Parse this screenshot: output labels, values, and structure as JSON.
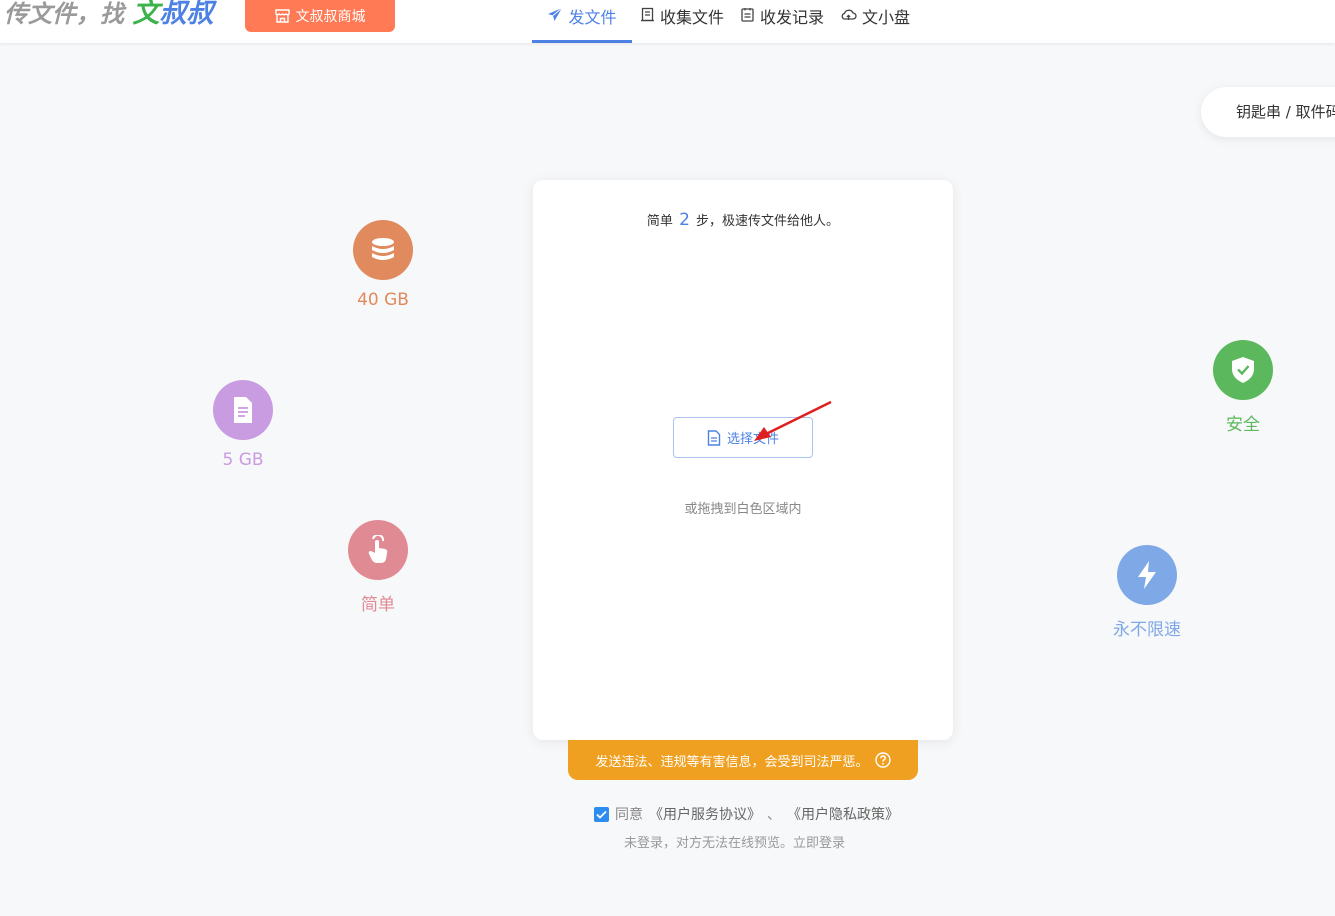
{
  "header": {
    "logo_part1": "传文件，找 ",
    "logo_part2": "文",
    "logo_part3": "叔叔",
    "shop_button": "文叔叔商城",
    "nav": [
      {
        "label": "发文件",
        "icon": "send-icon"
      },
      {
        "label": "收集文件",
        "icon": "inbox-icon"
      },
      {
        "label": "收发记录",
        "icon": "record-icon"
      },
      {
        "label": "文小盘",
        "icon": "cloud-icon"
      }
    ],
    "key_input": "钥匙串 / 取件码"
  },
  "features": [
    {
      "label": "40 GB",
      "icon": "database-icon",
      "color": "#e08a5e"
    },
    {
      "label": "5 GB",
      "icon": "file-icon",
      "color": "#c99be0"
    },
    {
      "label": "简单",
      "icon": "hand-pointer-icon",
      "color": "#e08b94"
    },
    {
      "label": "安全",
      "icon": "shield-check-icon",
      "color": "#5cb85c"
    },
    {
      "label": "永不限速",
      "icon": "lightning-icon",
      "color": "#7fa8e6"
    }
  ],
  "card": {
    "tip_prefix": "简单",
    "tip_num": "2",
    "tip_suffix": "步，极速传文件给他人。",
    "select_button": "选择文件",
    "drag_tip": "或拖拽到白色区域内"
  },
  "warning": "发送违法、违规等有害信息，会受到司法严惩。",
  "agreement": {
    "agree": "同意",
    "service": "《用户服务协议》",
    "sep": "、",
    "privacy": "《用户隐私政策》"
  },
  "login": {
    "text": "未登录，对方无法在线预览。",
    "link": "立即登录"
  },
  "colors": {
    "accent": "#4d82e4",
    "shop": "#ff7a55",
    "warning": "#f0a021"
  }
}
